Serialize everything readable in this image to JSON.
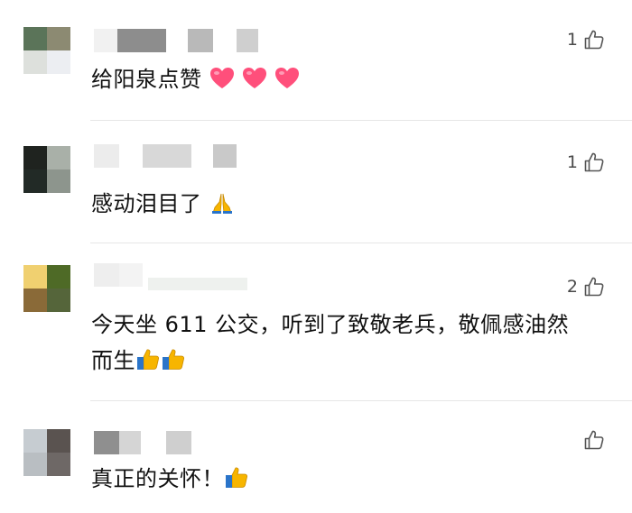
{
  "comments": [
    {
      "likes": "1",
      "text": "给阳泉点赞",
      "emoji": [
        "heart",
        "heart",
        "heart"
      ]
    },
    {
      "likes": "1",
      "text": "感动泪目了",
      "emoji": [
        "pray"
      ]
    },
    {
      "likes": "2",
      "text_line1": "今天坐 611 公交，听到了致敬老兵，敬佩感油然",
      "text_line2": "而生",
      "emoji": [
        "thumbs-up",
        "thumbs-up"
      ]
    },
    {
      "likes": "",
      "text": "真正的关怀！",
      "emoji": [
        "thumbs-up"
      ]
    }
  ],
  "colors": {
    "text": "#111111",
    "like_count": "#4a4a4a",
    "divider": "#e6e6e6",
    "heart": "#ff4f7b",
    "thumb": "#f7b500"
  }
}
